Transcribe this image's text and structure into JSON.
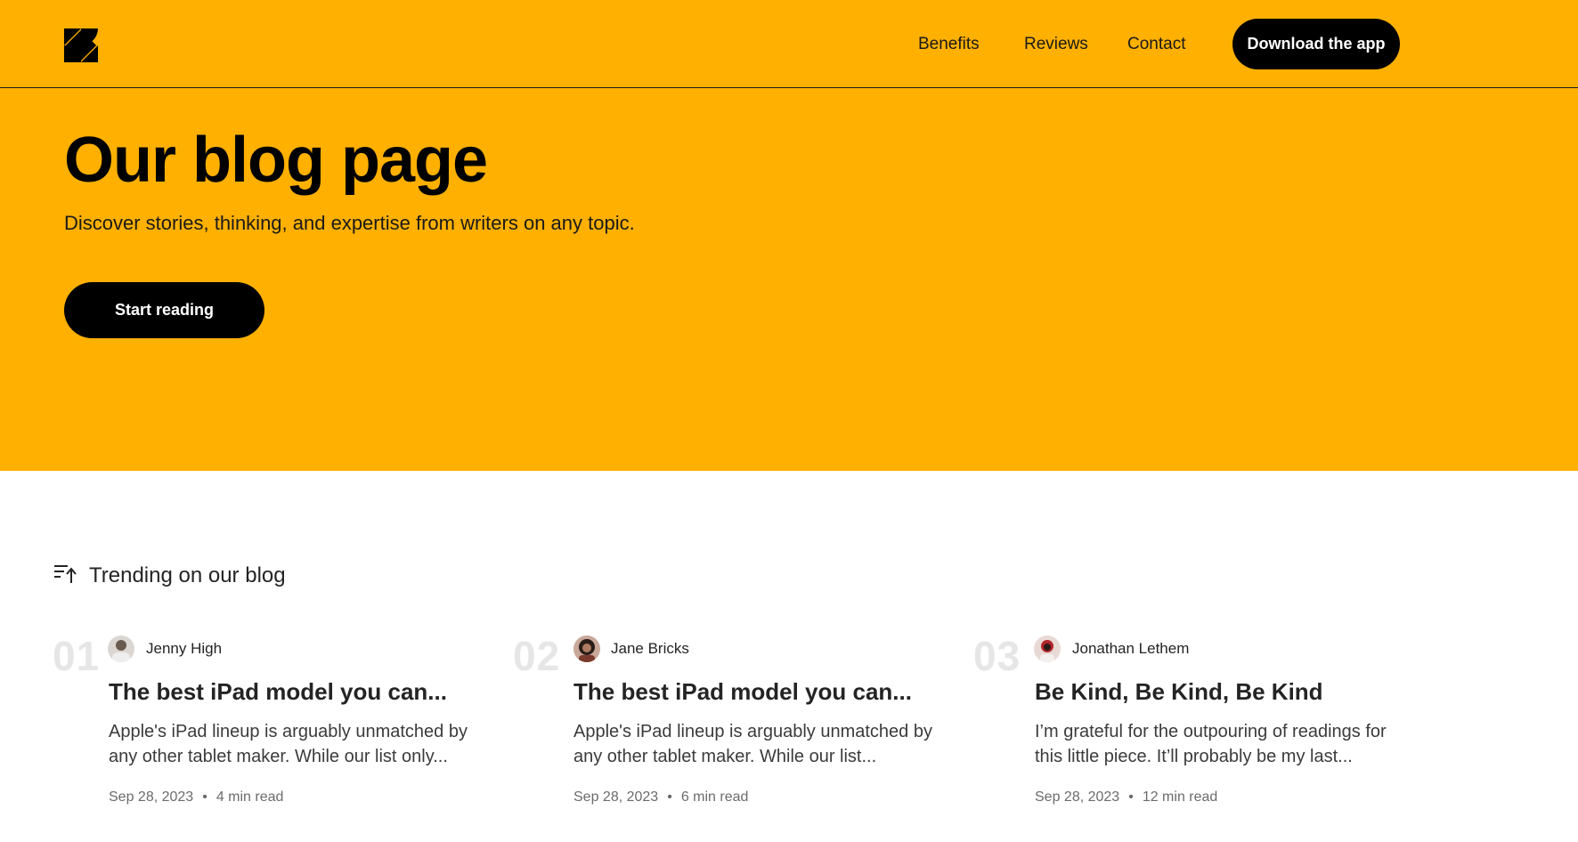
{
  "colors": {
    "accent": "#FFB000",
    "button": "#000000",
    "number": "#E6E6E6"
  },
  "nav": {
    "logo_icon": "four-petal-logo-icon",
    "links": [
      "Benefits",
      "Reviews",
      "Contact"
    ],
    "cta_label": "Download the app"
  },
  "hero": {
    "title": "Our blog page",
    "subtitle": "Discover stories, thinking, and expertise from writers on any topic.",
    "button_label": "Start reading"
  },
  "trending": {
    "icon": "sort-up-icon",
    "heading": "Trending on our blog",
    "posts": [
      {
        "number": "01",
        "author": "Jenny High",
        "title": "The best iPad model you can...",
        "excerpt": "Apple's iPad lineup is arguably unmatched by any other tablet maker. While our list only...",
        "date": "Sep 28, 2023",
        "separator": "•",
        "read_time": "4 min read"
      },
      {
        "number": "02",
        "author": "Jane Bricks",
        "title": "The best iPad model you can...",
        "excerpt": "Apple's iPad lineup is arguably unmatched by any other tablet maker. While our list...",
        "date": "Sep 28, 2023",
        "separator": "•",
        "read_time": "6 min read"
      },
      {
        "number": "03",
        "author": "Jonathan Lethem",
        "title": "Be Kind, Be Kind, Be Kind",
        "excerpt": "I’m grateful for the outpouring of readings for this little piece. It’ll probably be my last...",
        "date": "Sep 28, 2023",
        "separator": "•",
        "read_time": "12 min read"
      }
    ]
  }
}
